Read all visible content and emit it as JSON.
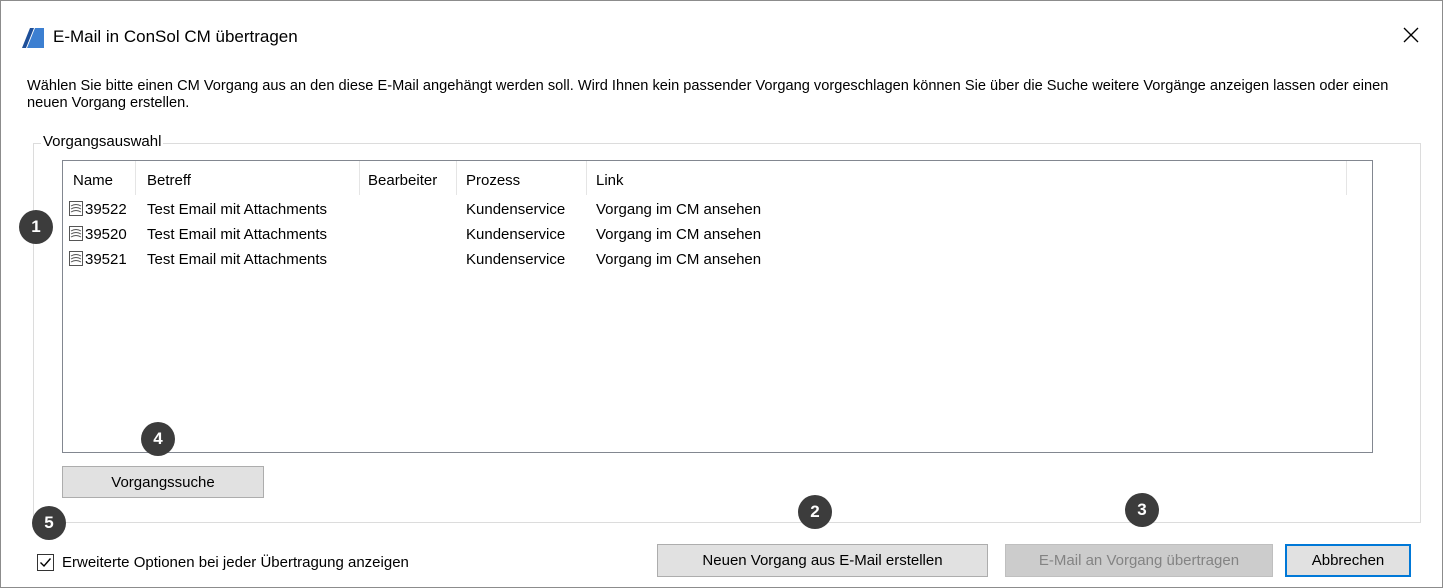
{
  "window": {
    "title": "E-Mail in ConSol CM übertragen",
    "app_icon": "consol-logo-icon",
    "close_icon": "close-icon"
  },
  "intro_text": "Wählen Sie bitte einen CM Vorgang aus an den diese E-Mail angehängt werden soll. Wird Ihnen kein passender Vorgang vorgeschlagen können Sie über die Suche weitere Vorgänge anzeigen lassen oder einen neuen Vorgang erstellen.",
  "selection": {
    "group_label": "Vorgangsauswahl",
    "columns": [
      "Name",
      "Betreff",
      "Bearbeiter",
      "Prozess",
      "Link"
    ],
    "rows": [
      {
        "name": "39522",
        "betreff": "Test Email mit Attachments",
        "bearbeiter": "",
        "prozess": "Kundenservice",
        "link": "Vorgang im CM ansehen",
        "icon": "ticket-icon"
      },
      {
        "name": "39520",
        "betreff": "Test Email mit Attachments",
        "bearbeiter": "",
        "prozess": "Kundenservice",
        "link": "Vorgang im CM ansehen",
        "icon": "ticket-icon"
      },
      {
        "name": "39521",
        "betreff": "Test Email mit Attachments",
        "bearbeiter": "",
        "prozess": "Kundenservice",
        "link": "Vorgang im CM ansehen",
        "icon": "ticket-icon"
      }
    ],
    "search_button": "Vorgangssuche"
  },
  "options": {
    "checkbox_label": "Erweiterte Optionen bei jeder Übertragung anzeigen",
    "checked": true
  },
  "buttons": {
    "new_ticket": "Neuen Vorgang aus E-Mail erstellen",
    "transfer": "E-Mail an Vorgang übertragen",
    "cancel": "Abbrechen"
  },
  "badges": [
    "1",
    "2",
    "3",
    "4",
    "5"
  ],
  "colors": {
    "badge_bg": "#3c3c3c",
    "button_bg": "#e1e1e1",
    "default_border": "#0078d7",
    "disabled_text": "#838383"
  }
}
